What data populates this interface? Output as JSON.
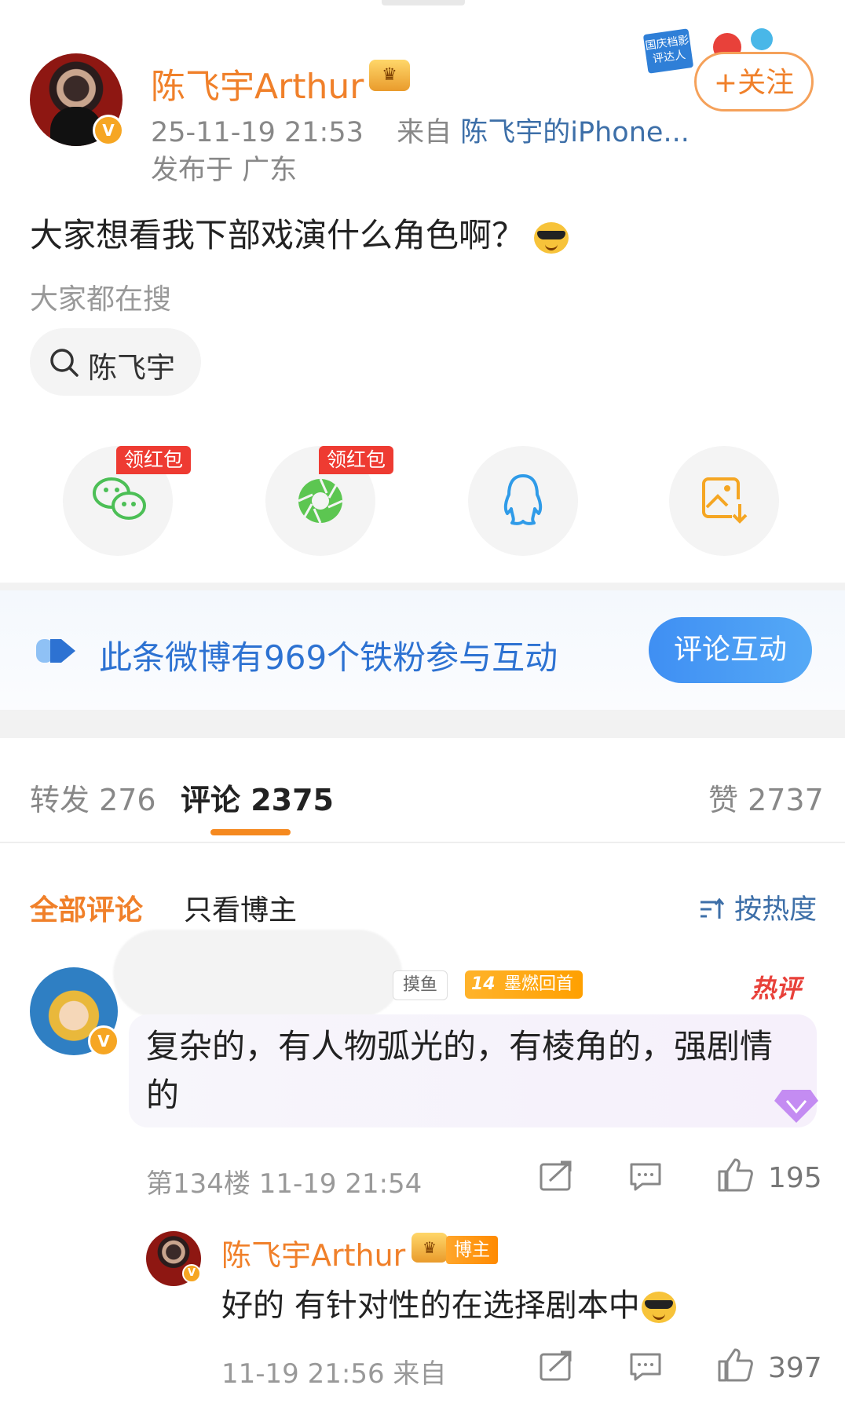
{
  "post": {
    "author_name": "陈飞宇Arthur",
    "time": "25-11-19 21:53",
    "source_prefix": "来自",
    "source": "陈飞宇的iPhone...",
    "location": "发布于 广东",
    "follow_label": "+关注",
    "sticker_text": "国庆档影评达人",
    "text": "大家想看我下部戏演什么角色啊？",
    "verified_badge": "V"
  },
  "search": {
    "label": "大家都在搜",
    "query": "陈飞宇"
  },
  "share": {
    "red_packet_label": "领红包",
    "items": [
      {
        "icon": "wechat-icon",
        "color": "#4cbf56",
        "has_red_packet": true
      },
      {
        "icon": "moments-icon",
        "color": "#5cc651",
        "has_red_packet": true
      },
      {
        "icon": "qq-icon",
        "color": "#2f9be8",
        "has_red_packet": false
      },
      {
        "icon": "save-image-icon",
        "color": "#f5a623",
        "has_red_packet": false
      }
    ]
  },
  "fans": {
    "text": "此条微博有969个铁粉参与互动",
    "button": "评论互动"
  },
  "tabs": {
    "repost": "转发 276",
    "comment": "评论 2375",
    "like": "赞 2737"
  },
  "filters": {
    "all": "全部评论",
    "author_only": "只看博主",
    "sort": "按热度"
  },
  "comment": {
    "tag_fish": "摸鱼",
    "level_num": "14",
    "level_text": "墨燃回首",
    "hot_label": "热评",
    "text": "复杂的，有人物弧光的，有棱角的，强剧情的",
    "floor": "第134楼",
    "time": "11-19 21:54",
    "likes": "195"
  },
  "reply": {
    "author_name": "陈飞宇Arthur",
    "badge": "博主",
    "text": "好的 有针对性的在选择剧本中",
    "time": "11-19 21:56",
    "source": "来自",
    "likes": "397"
  },
  "colors": {
    "accent_orange": "#f0802a",
    "link_blue": "#3d6fa8",
    "fan_blue": "#2d72d2",
    "red": "#ee3b32"
  }
}
